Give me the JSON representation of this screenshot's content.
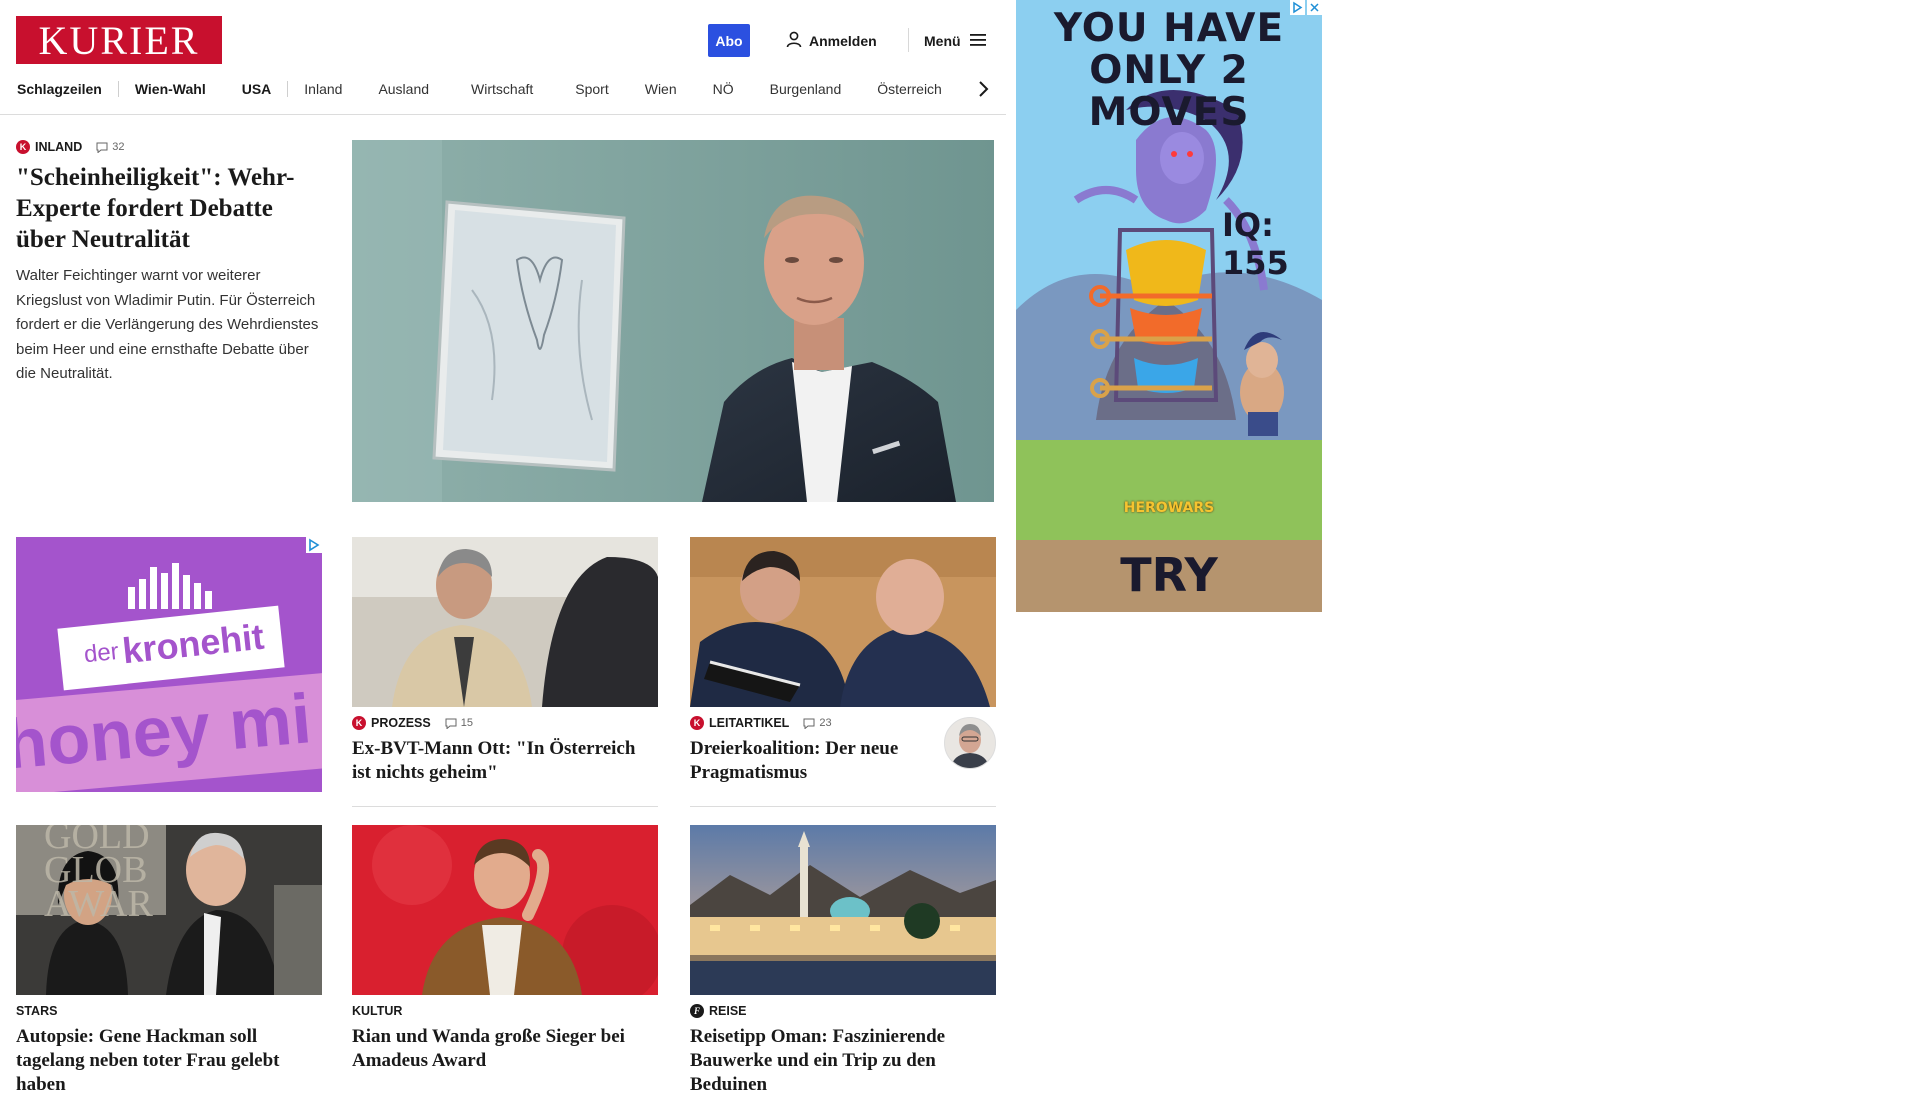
{
  "header": {
    "logo": "KURIER",
    "abo_label": "Abo",
    "login_label": "Anmelden",
    "menu_label": "Menü"
  },
  "nav": {
    "items": [
      "Schlagzeilen",
      "Wien-Wahl",
      "USA",
      "Inland",
      "Ausland",
      "Wirtschaft",
      "Sport",
      "Wien",
      "NÖ",
      "Burgenland",
      "Österreich"
    ]
  },
  "lead": {
    "kicker": "INLAND",
    "comments": "32",
    "headline": "\"Scheinheiligkeit\": Wehr-Experte fordert Debatte über Neutralität",
    "teaser": "Walter Feichtinger warnt vor weiterer Kriegslust von Wladimir Putin. Für Österreich fordert er die Verlängerung des Wehrdienstes beim Heer und eine ernsthafte Debatte über die Neutralität."
  },
  "ad_left": {
    "brand_prefix": "der",
    "brand_name": "kronehit",
    "slogan": "honey mi"
  },
  "ad_right": {
    "line1": "YOU HAVE",
    "line2": "ONLY 2 MOVES",
    "iq": "IQ: 155",
    "game_logo": "HEROWARS",
    "cta": "TRY"
  },
  "articles": [
    {
      "kicker": "PROZESS",
      "comments": "15",
      "headline": "Ex-BVT-Mann Ott: \"In Österreich ist nichts geheim\""
    },
    {
      "kicker": "LEITARTIKEL",
      "comments": "23",
      "headline": "Dreierkoalition: Der neue Pragmatismus"
    },
    {
      "kicker": "STARS",
      "headline": "Autopsie: Gene Hackman soll tagelang neben toter Frau gelebt haben"
    },
    {
      "kicker": "KULTUR",
      "headline": "Rian und Wanda große Sieger bei Amadeus Award"
    },
    {
      "kicker": "REISE",
      "headline": "Reisetipp Oman: Faszinierende Bauwerke und ein Trip zu den Beduinen"
    }
  ],
  "image_text": {
    "golden_globe": "GOLD GLOB AWAR"
  },
  "colors": {
    "brand_red": "#c8102e",
    "abo_blue": "#2b50e0",
    "ad_purple": "#a454cc",
    "ad_sky": "#8ccff0"
  }
}
